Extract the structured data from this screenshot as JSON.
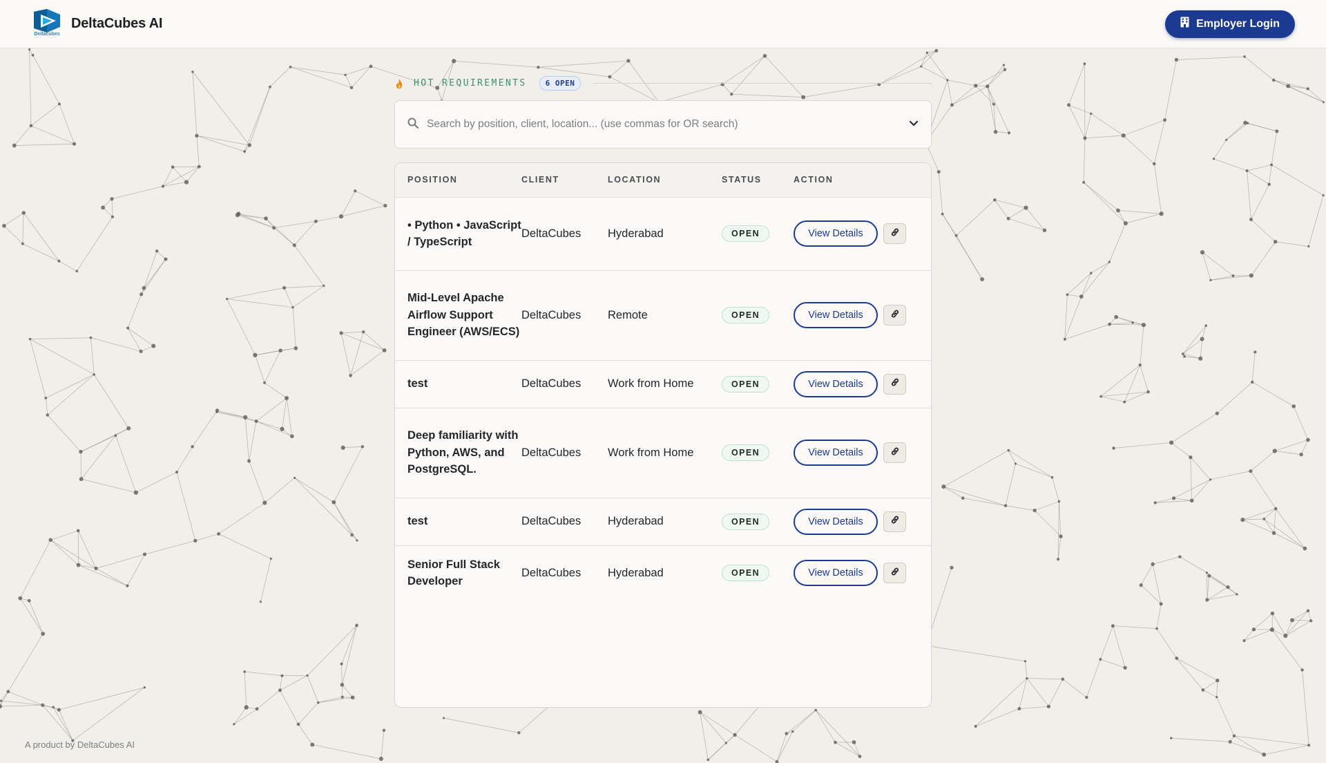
{
  "header": {
    "logo_text": "Deltacubes",
    "brand_name": "DeltaCubes AI",
    "login_label": "Employer Login"
  },
  "section": {
    "title": "HOT REQUIREMENTS",
    "count_badge": "6 OPEN"
  },
  "search": {
    "placeholder": "Search by position, client, location... (use commas for OR search)"
  },
  "table": {
    "columns": [
      "POSITION",
      "CLIENT",
      "LOCATION",
      "STATUS",
      "ACTION"
    ],
    "action_label": "View Details",
    "rows": [
      {
        "position": "• Python • JavaScript / TypeScript",
        "client": "DeltaCubes",
        "location": "Hyderabad",
        "status": "OPEN"
      },
      {
        "position": "Mid-Level Apache Airflow Support Engineer (AWS/ECS)",
        "client": "DeltaCubes",
        "location": "Remote",
        "status": "OPEN"
      },
      {
        "position": "test",
        "client": "DeltaCubes",
        "location": "Work from Home",
        "status": "OPEN"
      },
      {
        "position": "Deep familiarity with Python, AWS, and PostgreSQL.",
        "client": "DeltaCubes",
        "location": "Work from Home",
        "status": "OPEN"
      },
      {
        "position": "test",
        "client": "DeltaCubes",
        "location": "Hyderabad",
        "status": "OPEN"
      },
      {
        "position": "Senior Full Stack Developer",
        "client": "DeltaCubes",
        "location": "Hyderabad",
        "status": "OPEN"
      }
    ]
  },
  "footer": {
    "text": "A product by DeltaCubes AI"
  },
  "colors": {
    "primary": "#1c3a8f",
    "accent_green": "#3e8f6a",
    "background": "#f1efea"
  },
  "icons": {
    "logo": "deltacubes-logo-icon",
    "login": "building-icon",
    "section": "flame-icon",
    "search": "search-icon",
    "dropdown": "chevron-down-icon",
    "row_link": "link-icon"
  }
}
